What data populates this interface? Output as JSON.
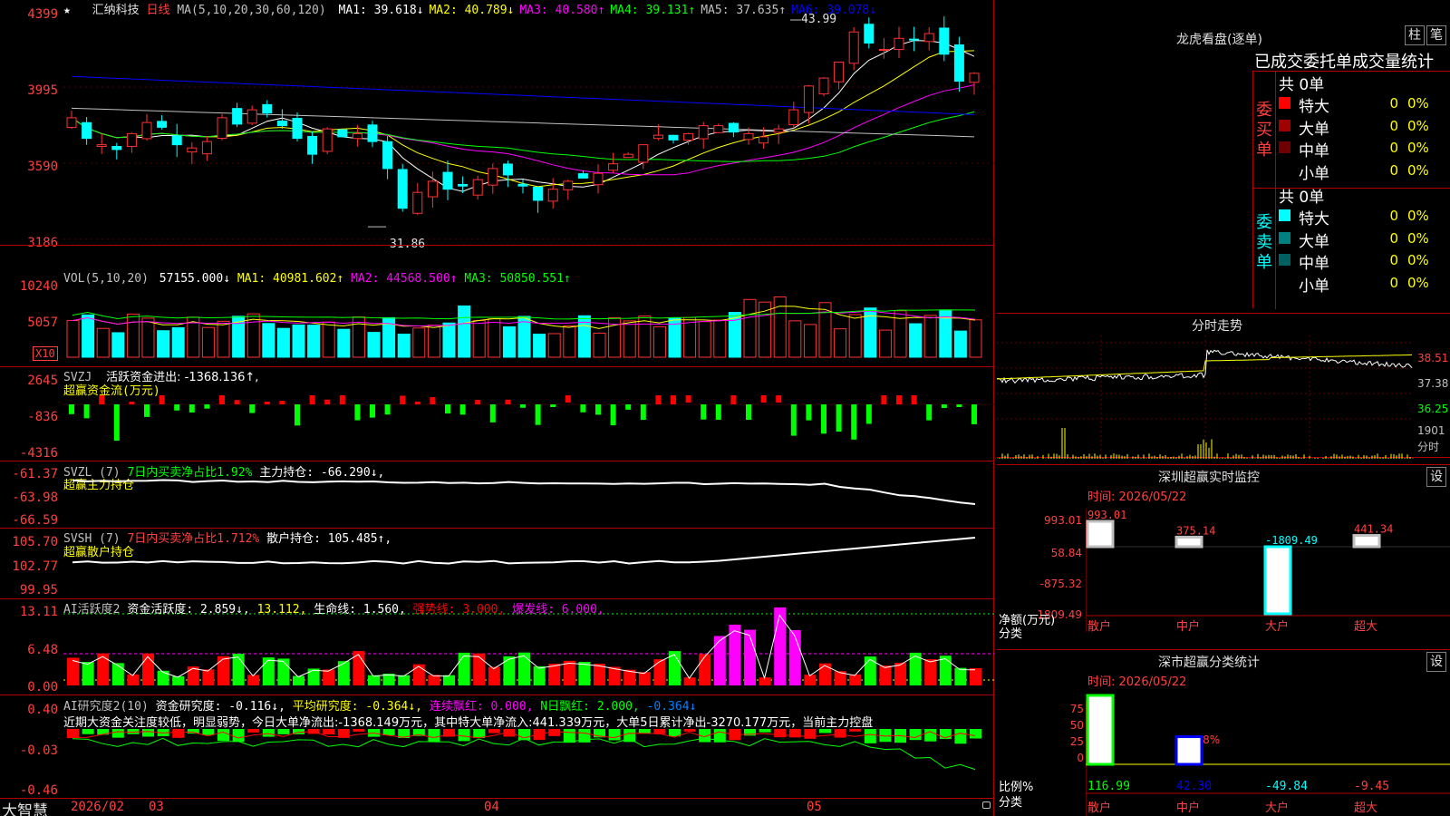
{
  "header": {
    "star": "★",
    "stock_name": "汇纳科技",
    "period": "日线",
    "ma_params": "MA(5,10,20,30,60,120)",
    "ma": [
      {
        "label": "MA1:",
        "value": "39.618↓",
        "color": "#ffffff"
      },
      {
        "label": "MA2:",
        "value": "40.789↓",
        "color": "#ffff00"
      },
      {
        "label": "MA3:",
        "value": "40.580↑",
        "color": "#ff00ff"
      },
      {
        "label": "MA4:",
        "value": "39.131↑",
        "color": "#00ff00"
      },
      {
        "label": "MA5:",
        "value": "37.635↑",
        "color": "#c0c0c0"
      },
      {
        "label": "MA6:",
        "value": "39.078↓",
        "color": "#0000ff"
      }
    ]
  },
  "price_axis": [
    "4399",
    "3995",
    "3590",
    "3186"
  ],
  "price_marks": {
    "high": "43.99",
    "low": "31.86"
  },
  "vol_panel": {
    "title": "VOL(5,10,20)",
    "value": "57155.000↓",
    "ma1": "MA1: 40981.602↑",
    "ma2": "MA2: 44568.500↑",
    "ma3": "MA3: 50850.551↑",
    "axis": [
      "10240",
      "5057"
    ],
    "unit": "X10"
  },
  "svzj_panel": {
    "title": "SVZJ",
    "label": "活跃资金进出: -1368.136↑,",
    "sub": "超赢资金流(万元)",
    "axis": [
      "2645",
      "-836",
      "-4316"
    ]
  },
  "svzl_panel": {
    "title": "SVZL (7)",
    "label1": "7日内买卖净占比1.92%",
    "label2": "主力持仓: -66.290↓,",
    "sub": "超赢主力持仓",
    "axis": [
      "-61.37",
      "-63.98",
      "-66.59"
    ]
  },
  "svsh_panel": {
    "title": "SVSH (7)",
    "label1": "7日内买卖净占比1.712%",
    "label2": "散户持仓: 105.485↑,",
    "sub": "超赢散户持仓",
    "axis": [
      "105.70",
      "102.77",
      "99.95"
    ]
  },
  "ai_active": {
    "title": "AI活跃度2",
    "l1": "资金活跃度: 2.859↓,",
    "l2": "13.112,",
    "l3": "生命线: 1.560,",
    "l4": "强势线: 3.000,",
    "l5": "爆发线: 6.000,",
    "axis": [
      "13.11",
      "6.48",
      "0.00"
    ]
  },
  "ai_research": {
    "title": "AI研究度2(10)",
    "l1": "资金研究度: -0.116↓,",
    "l2": "平均研究度: -0.364↓,",
    "l3": "连续飘红: 0.000,",
    "l4": "N日飘红: 2.000,",
    "l5": "-0.364↓",
    "comment": "近期大资金关注度较低，明显弱势，今日大单净流出:-1368.149万元，其中特大单净流入:441.339万元，大单5日累计净出-3270.177万元，当前主力控盘",
    "axis": [
      "0.40",
      "-0.03",
      "-0.46"
    ]
  },
  "date_axis": {
    "brand": "大智慧",
    "labels": [
      "2026/02",
      "03",
      "04",
      "05"
    ]
  },
  "longhu": {
    "title": "龙虎看盘(逐单)",
    "btn_zhu": "柱",
    "btn_bi": "笔",
    "header": "已成交委托单成交量统计",
    "buy": {
      "label": "委买单",
      "total": "共 0单",
      "rows": [
        {
          "name": "特大",
          "val": "0",
          "pct": "0%",
          "color": "#ff0000"
        },
        {
          "name": "大单",
          "val": "0",
          "pct": "0%",
          "color": "#a00000"
        },
        {
          "name": "中单",
          "val": "0",
          "pct": "0%",
          "color": "#700000"
        },
        {
          "name": "小单",
          "val": "0",
          "pct": "0%",
          "color": "#000000"
        }
      ]
    },
    "sell": {
      "label": "委卖单",
      "total": "共 0单",
      "rows": [
        {
          "name": "特大",
          "val": "0",
          "pct": "0%",
          "color": "#00ffff"
        },
        {
          "name": "大单",
          "val": "0",
          "pct": "0%",
          "color": "#008080"
        },
        {
          "name": "中单",
          "val": "0",
          "pct": "0%",
          "color": "#006060"
        },
        {
          "name": "小单",
          "val": "0",
          "pct": "0%",
          "color": "#000000"
        }
      ]
    }
  },
  "intraday": {
    "title": "分时走势",
    "prices": [
      "38.51",
      "37.38",
      "36.25"
    ],
    "vol": "1901",
    "vol_label": "分时"
  },
  "monitor": {
    "title": "深圳超赢实时监控",
    "btn": "设",
    "time": "时间: 2026/05/22",
    "axis": [
      "993.01",
      "58.84",
      "-875.32",
      "-1809.49"
    ],
    "ylabel1": "净额(万元)",
    "ylabel2": "分类",
    "bars": [
      {
        "cat": "散户",
        "val": "993.01"
      },
      {
        "cat": "中户",
        "val": "375.14"
      },
      {
        "cat": "大户",
        "val": "-1809.49"
      },
      {
        "cat": "超大",
        "val": "441.34"
      }
    ]
  },
  "classify": {
    "title": "深市超赢分类统计",
    "btn": "设",
    "time": "时间: 2026/05/22",
    "axis": [
      "75",
      "50",
      "25",
      "0"
    ],
    "ylabel1": "比例%",
    "ylabel2": "分类",
    "mark": "+0.08%",
    "bars": [
      {
        "cat": "散户",
        "val": "116.99"
      },
      {
        "cat": "中户",
        "val": "42.30"
      },
      {
        "cat": "大户",
        "val": "-49.84"
      },
      {
        "cat": "超大",
        "val": "-9.45"
      }
    ]
  }
}
